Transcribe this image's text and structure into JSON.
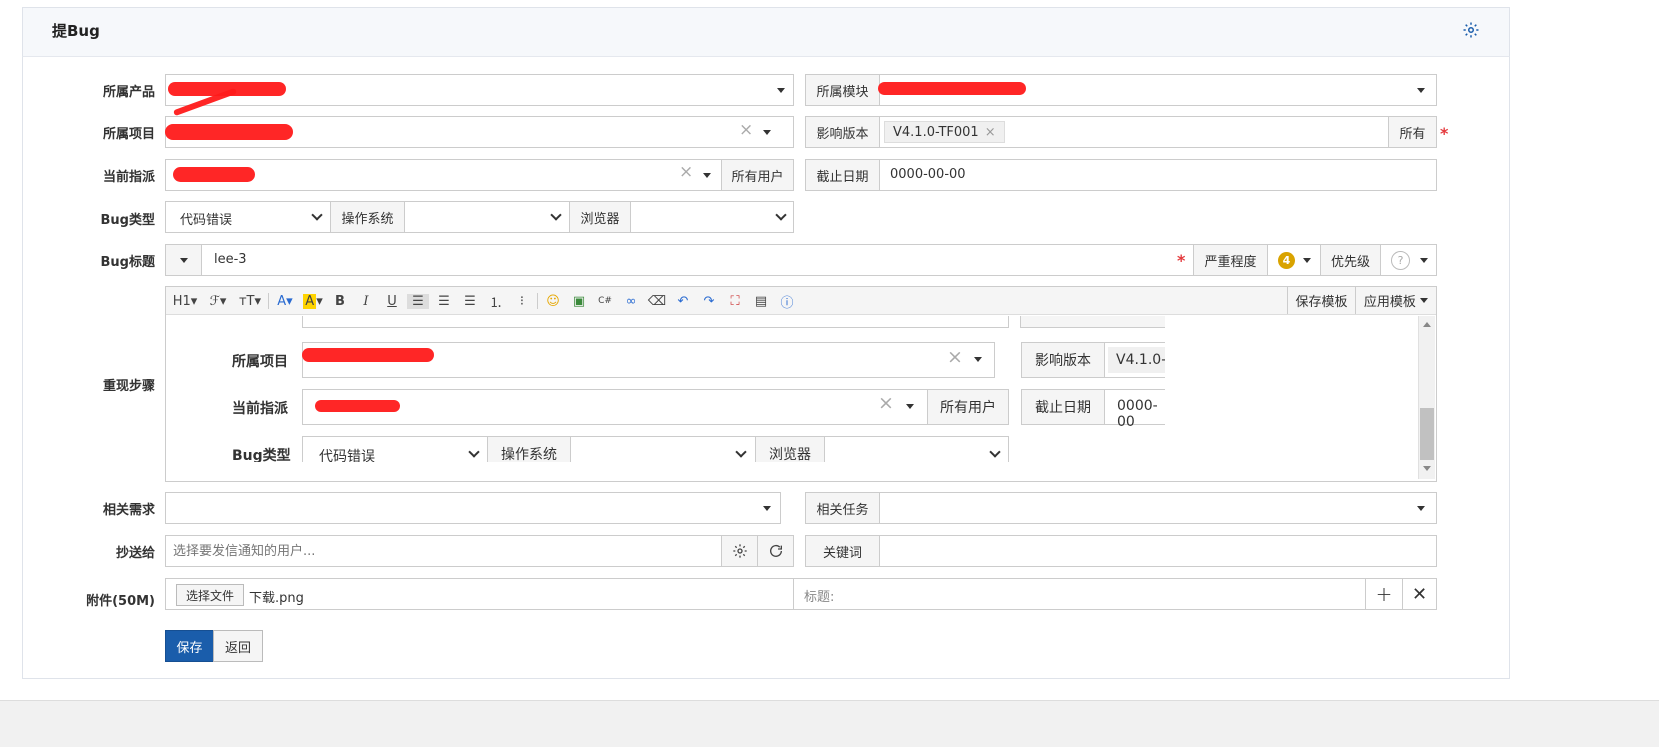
{
  "panel": {
    "title": "提Bug"
  },
  "form": {
    "product": {
      "label": "所属产品",
      "value": ""
    },
    "module": {
      "label": "所属模块",
      "value": ""
    },
    "project": {
      "label": "所属项目",
      "value": ""
    },
    "version": {
      "label": "影响版本",
      "tag": "V4.1.0-TF001",
      "all_button": "所有"
    },
    "assign": {
      "label": "当前指派",
      "all_users_button": "所有用户"
    },
    "deadline": {
      "label": "截止日期",
      "value": "0000-00-00"
    },
    "bug_type": {
      "label": "Bug类型",
      "value": "代码错误"
    },
    "os": {
      "label": "操作系统",
      "value": ""
    },
    "browser": {
      "label": "浏览器",
      "value": ""
    },
    "title": {
      "label": "Bug标题",
      "value": "lee-3"
    },
    "severity": {
      "label": "严重程度",
      "value": "4"
    },
    "priority": {
      "label": "优先级",
      "value": "?"
    },
    "steps": {
      "label": "重现步骤"
    },
    "story": {
      "label": "相关需求",
      "value": ""
    },
    "task": {
      "label": "相关任务",
      "value": ""
    },
    "mailto": {
      "label": "抄送给",
      "placeholder": "选择要发信通知的用户..."
    },
    "keywords": {
      "label": "关键词",
      "value": ""
    },
    "files": {
      "label": "附件(50M)",
      "choose_button": "选择文件",
      "file_name": "下载.png",
      "title_placeholder": "标题:"
    }
  },
  "editor": {
    "toolbar": {
      "h1": "H1",
      "save_template": "保存模板",
      "apply_template": "应用模板"
    },
    "inner": {
      "project_label": "所属项目",
      "version_label": "影响版本",
      "version_value": "V4.1.0-",
      "assign_label": "当前指派",
      "all_users": "所有用户",
      "deadline_label": "截止日期",
      "deadline_value": "0000-00",
      "bug_type_label": "Bug类型",
      "bug_type_value": "代码错误",
      "os_label": "操作系统",
      "browser_label": "浏览器"
    }
  },
  "actions": {
    "save": "保存",
    "back": "返回"
  },
  "colors": {
    "primary": "#1a5dab",
    "required": "#e4393c",
    "severity_badge": "#d9a300"
  }
}
